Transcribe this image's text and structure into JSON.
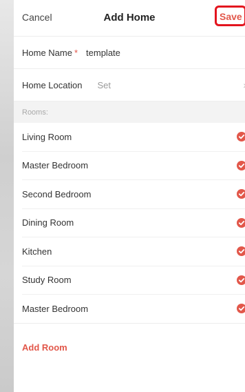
{
  "header": {
    "cancel_label": "Cancel",
    "title": "Add Home",
    "save_label": "Save"
  },
  "form": {
    "home_name_label": "Home Name",
    "required_marker": "*",
    "home_name_value": "template",
    "home_location_label": "Home Location",
    "home_location_value": "Set",
    "home_location_icon": "chevron-right-icon"
  },
  "rooms_section": {
    "label": "Rooms:",
    "items": [
      {
        "label": "Living Room",
        "checked": true
      },
      {
        "label": "Master Bedroom",
        "checked": true
      },
      {
        "label": "Second Bedroom",
        "checked": true
      },
      {
        "label": "Dining Room",
        "checked": true
      },
      {
        "label": "Kitchen",
        "checked": true
      },
      {
        "label": "Study Room",
        "checked": true
      },
      {
        "label": "Master Bedroom",
        "checked": true
      }
    ],
    "add_room_label": "Add Room"
  },
  "colors": {
    "accent": "#e2574a",
    "highlight_border": "#e3141e"
  }
}
